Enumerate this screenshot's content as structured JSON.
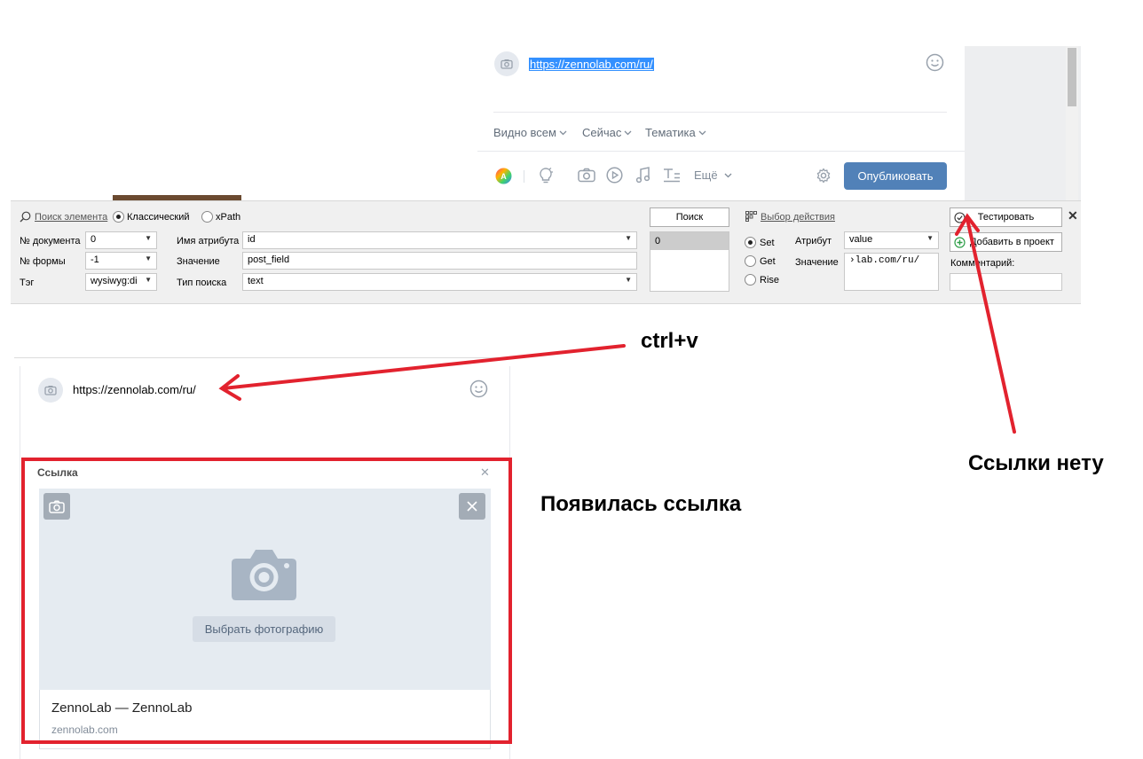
{
  "top_composer": {
    "url_selected": "https://zennolab.com/ru/",
    "menu": [
      {
        "label": "Видно всем"
      },
      {
        "label": "Сейчас"
      },
      {
        "label": "Тематика"
      }
    ],
    "more_label": "Ещё",
    "publish_label": "Опубликовать"
  },
  "zenno_panel": {
    "search_element_label": "Поиск элемента",
    "mode_classic": "Классический",
    "mode_xpath": "xPath",
    "doc_no_label": "№ документа",
    "doc_no_value": "0",
    "form_no_label": "№ формы",
    "form_no_value": "-1",
    "tag_label": "Тэг",
    "tag_value": "wysiwyg:di",
    "attr_name_label": "Имя атрибута",
    "attr_name_value": "id",
    "value_label": "Значение",
    "value_value": "post_field",
    "search_type_label": "Тип поиска",
    "search_type_value": "text",
    "search_button": "Поиск",
    "results": [
      "0"
    ],
    "action_label": "Выбор действия",
    "action_set": "Set",
    "action_get": "Get",
    "action_rise": "Rise",
    "attribute_label": "Атрибут",
    "attribute_value": "value",
    "action_value_label": "Значение",
    "action_value": "›lab.com/ru/",
    "test_button": "Тестировать",
    "add_to_project_button": "Добавить в проект",
    "comment_label": "Комментарий:"
  },
  "bottom_composer": {
    "url": "https://zennolab.com/ru/",
    "card_title": "Ссылка",
    "pick_photo": "Выбрать фотографию",
    "link_title": "ZennoLab — ZennoLab",
    "link_domain": "zennolab.com"
  },
  "annotations": {
    "ctrlv": "ctrl+v",
    "no_link": "Ссылки нету",
    "link_appeared": "Появилась ссылка"
  },
  "colors": {
    "vk_blue": "#5181b8",
    "selection": "#3390ff",
    "annotation_red": "#e2222e"
  }
}
